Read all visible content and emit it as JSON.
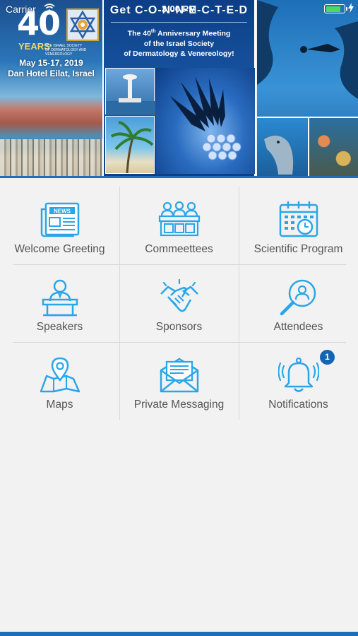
{
  "status_bar": {
    "carrier": "Carrier",
    "time": "3:00 PM",
    "battery_level": 0.85,
    "battery_color": "#4cd964"
  },
  "banner": {
    "big_number": "40",
    "years_word": "YEARS",
    "society_small": "THE ISRAEL SOCIETY OF DERMATOLOGY AND VENEREOLOGY",
    "dates": "May 15-17, 2019",
    "venue": "Dan Hotel Eilat, Israel",
    "headline": "Get C-O-N-N-E-C-T-E-D",
    "anniversary_line1": "The 40",
    "anniversary_sup": "th",
    "anniversary_line1_rest": " Anniversary Meeting",
    "anniversary_line2": "of the Israel Society",
    "anniversary_line3": "of Dermatology & Venereology!"
  },
  "accent_color": "#2aa6e8",
  "menu": [
    {
      "label": "Welcome Greeting",
      "icon": "news-icon"
    },
    {
      "label": "Commeettees",
      "icon": "committee-icon"
    },
    {
      "label": "Scientific Program",
      "icon": "calendar-icon"
    },
    {
      "label": "Speakers",
      "icon": "speaker-icon"
    },
    {
      "label": "Sponsors",
      "icon": "handshake-icon"
    },
    {
      "label": "Attendees",
      "icon": "search-person-icon"
    },
    {
      "label": "Maps",
      "icon": "map-icon"
    },
    {
      "label": "Private Messaging",
      "icon": "envelope-icon"
    },
    {
      "label": "Notifications",
      "icon": "bell-icon"
    }
  ],
  "notifications_badge": "1"
}
